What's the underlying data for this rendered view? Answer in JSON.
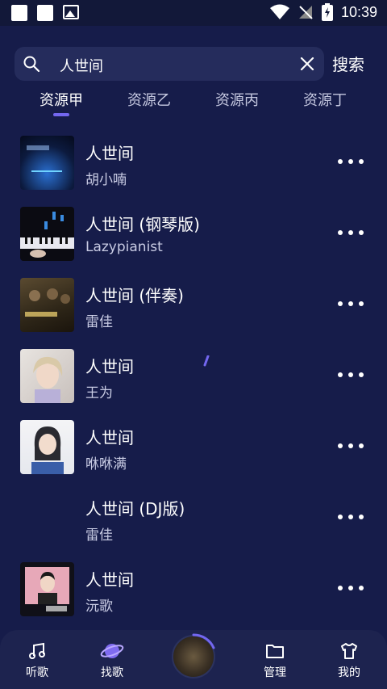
{
  "status_bar": {
    "time": "10:39"
  },
  "search": {
    "query": "人世间",
    "button_label": "搜索"
  },
  "tabs": [
    {
      "label": "资源甲",
      "active": true
    },
    {
      "label": "资源乙",
      "active": false
    },
    {
      "label": "资源丙",
      "active": false
    },
    {
      "label": "资源丁",
      "active": false
    }
  ],
  "songs": [
    {
      "title": "人世间",
      "artist": "胡小喃"
    },
    {
      "title": "人世间 (钢琴版)",
      "artist": "Lazypianist"
    },
    {
      "title": "人世间 (伴奏)",
      "artist": "雷佳"
    },
    {
      "title": "人世间",
      "artist": "王为"
    },
    {
      "title": "人世间",
      "artist": "咻咻满"
    },
    {
      "title": "人世间 (DJ版)",
      "artist": "雷佳"
    },
    {
      "title": "人世间",
      "artist": "沅歌"
    }
  ],
  "bottom_nav": [
    {
      "label": "听歌",
      "icon": "music-note-icon"
    },
    {
      "label": "找歌",
      "icon": "planet-icon"
    },
    {
      "label": "管理",
      "icon": "folder-icon"
    },
    {
      "label": "我的",
      "icon": "tshirt-icon"
    }
  ],
  "colors": {
    "background": "#161c4a",
    "accent": "#7367ef",
    "search_bg": "#252c5c"
  }
}
